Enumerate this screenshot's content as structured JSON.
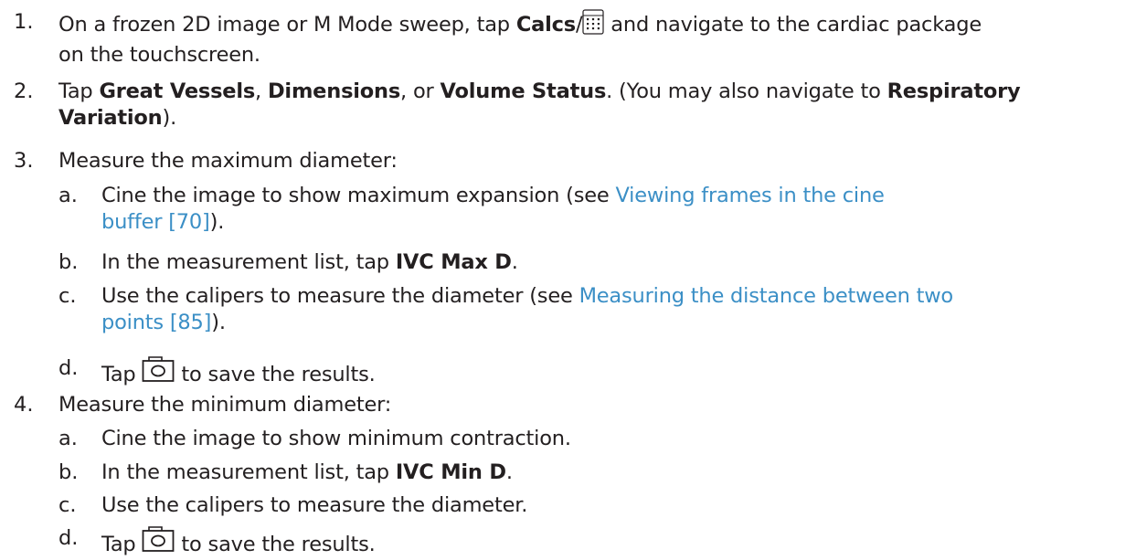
{
  "steps": [
    {
      "num": "1.",
      "line1_pre": "On a frozen 2D image or M Mode sweep, tap ",
      "calcs_label": "Calcs",
      "slash": "/",
      "calc_icon": "calculator-icon",
      "line1_post": " and navigate to the cardiac package",
      "line2": "on the touchscreen."
    },
    {
      "num": "2.",
      "pre": "Tap ",
      "great_vessels": "Great Vessels",
      "comma1": ", ",
      "dimensions": "Dimensions",
      "comma2": ", or ",
      "volume_status": "Volume Status",
      "mid": ". (You may also navigate to ",
      "respiratory": "Respiratory",
      "variation": "Variation",
      "end": ")."
    },
    {
      "num": "3.",
      "text": "Measure the maximum diameter:",
      "substeps": [
        {
          "num": "a.",
          "pre": "Cine the image to show maximum expansion (see ",
          "link_line1": "Viewing frames in the cine",
          "link_line2": "buffer [70]",
          "post": ")."
        },
        {
          "num": "b.",
          "pre": "In the measurement list, tap ",
          "bold": "IVC Max D",
          "post": "."
        },
        {
          "num": "c.",
          "pre": "Use the calipers to measure the diameter (see ",
          "link_line1": "Measuring the distance between two",
          "link_line2": "points [85]",
          "post": ")."
        },
        {
          "num": "d.",
          "pre": "Tap ",
          "icon": "camera-icon",
          "post": " to save the results."
        }
      ]
    },
    {
      "num": "4.",
      "text": "Measure the minimum diameter:",
      "substeps": [
        {
          "num": "a.",
          "text": "Cine the image to show minimum contraction."
        },
        {
          "num": "b.",
          "pre": "In the measurement list, tap ",
          "bold": "IVC Min D",
          "post": "."
        },
        {
          "num": "c.",
          "text": "Use the calipers to measure the diameter."
        },
        {
          "num": "d.",
          "pre": "Tap ",
          "icon": "camera-icon",
          "post": " to save the results."
        }
      ]
    }
  ],
  "colors": {
    "text": "#231f20",
    "link": "#3b8fc6"
  }
}
